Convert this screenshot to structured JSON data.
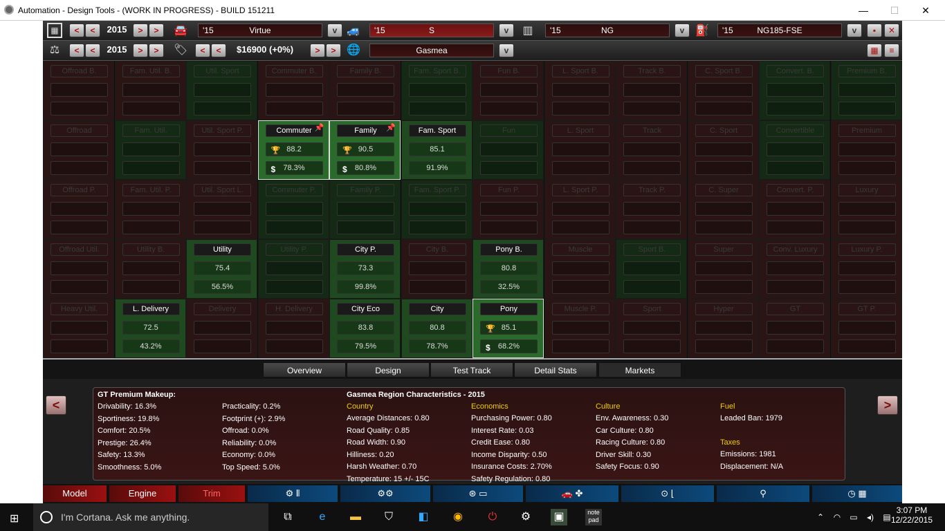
{
  "window": {
    "title": "Automation - Design Tools - (WORK IN PROGRESS) - BUILD 151211",
    "minimize": "—",
    "maximize": "☐",
    "close": "✕"
  },
  "toolbar1": {
    "year": "2015",
    "model_year": "'15",
    "model_name": "Virtue",
    "trim_year": "'15",
    "trim_name": "S",
    "chassis_year": "'15",
    "chassis_name": "NG",
    "engine_year": "'15",
    "engine_name": "NG185-FSE"
  },
  "toolbar2": {
    "year": "2015",
    "price": "$16900 (+0%)",
    "region": "Gasmea"
  },
  "grid": {
    "rows": [
      [
        {
          "label": "Offroad B.",
          "state": "dim",
          "color": "red"
        },
        {
          "label": "Fam. Util. B.",
          "state": "dim",
          "color": "red"
        },
        {
          "label": "Util. Sport",
          "state": "dim",
          "color": "green"
        },
        {
          "label": "Commuter B.",
          "state": "dim",
          "color": "red"
        },
        {
          "label": "Family B.",
          "state": "dim",
          "color": "red"
        },
        {
          "label": "Fam. Sport B.",
          "state": "dim",
          "color": "green"
        },
        {
          "label": "Fun B.",
          "state": "dim",
          "color": "red"
        },
        {
          "label": "L. Sport B.",
          "state": "dim",
          "color": "red"
        },
        {
          "label": "Track B.",
          "state": "dim",
          "color": "red"
        },
        {
          "label": "C. Sport B.",
          "state": "dim",
          "color": "red"
        },
        {
          "label": "Convert. B.",
          "state": "dim",
          "color": "green"
        },
        {
          "label": "Premium B.",
          "state": "dim",
          "color": "green"
        }
      ],
      [
        {
          "label": "Offroad",
          "state": "dim",
          "color": "red"
        },
        {
          "label": "Fam. Util.",
          "state": "dim",
          "color": "green"
        },
        {
          "label": "Util. Sport P.",
          "state": "dim",
          "color": "red"
        },
        {
          "label": "Commuter",
          "state": "sel",
          "color": "greenbright",
          "v1": "88.2",
          "v2": "78.3%",
          "trophy": true
        },
        {
          "label": "Family",
          "state": "sel",
          "color": "greenbright",
          "v1": "90.5",
          "v2": "80.8%",
          "trophy": true
        },
        {
          "label": "Fam. Sport",
          "state": "lit",
          "color": "green",
          "v1": "85.1",
          "v2": "91.9%"
        },
        {
          "label": "Fun",
          "state": "dim",
          "color": "green"
        },
        {
          "label": "L. Sport",
          "state": "dim",
          "color": "red"
        },
        {
          "label": "Track",
          "state": "dim",
          "color": "red"
        },
        {
          "label": "C. Sport",
          "state": "dim",
          "color": "red"
        },
        {
          "label": "Convertible",
          "state": "dim",
          "color": "green"
        },
        {
          "label": "Premium",
          "state": "dim",
          "color": "red"
        }
      ],
      [
        {
          "label": "Offroad P.",
          "state": "dim",
          "color": "red"
        },
        {
          "label": "Fam. Util. P.",
          "state": "dim",
          "color": "red"
        },
        {
          "label": "Util. Sport L.",
          "state": "dim",
          "color": "red"
        },
        {
          "label": "Commuter P.",
          "state": "dim",
          "color": "green"
        },
        {
          "label": "Family P.",
          "state": "dim",
          "color": "green"
        },
        {
          "label": "Fam. Sport P.",
          "state": "dim",
          "color": "green"
        },
        {
          "label": "Fun P.",
          "state": "dim",
          "color": "red"
        },
        {
          "label": "L. Sport P.",
          "state": "dim",
          "color": "red"
        },
        {
          "label": "Track P.",
          "state": "dim",
          "color": "red"
        },
        {
          "label": "C. Super",
          "state": "dim",
          "color": "red"
        },
        {
          "label": "Convert. P.",
          "state": "dim",
          "color": "red"
        },
        {
          "label": "Luxury",
          "state": "dim",
          "color": "red"
        }
      ],
      [
        {
          "label": "Offroad Util.",
          "state": "dim",
          "color": "red"
        },
        {
          "label": "Utility B.",
          "state": "dim",
          "color": "red"
        },
        {
          "label": "Utility",
          "state": "lit",
          "color": "green",
          "v1": "75.4",
          "v2": "56.5%"
        },
        {
          "label": "Utility P.",
          "state": "dim",
          "color": "green"
        },
        {
          "label": "City P.",
          "state": "lit",
          "color": "green",
          "v1": "73.3",
          "v2": "99.8%"
        },
        {
          "label": "City B.",
          "state": "dim",
          "color": "red"
        },
        {
          "label": "Pony B.",
          "state": "lit",
          "color": "green",
          "v1": "80.8",
          "v2": "32.5%"
        },
        {
          "label": "Muscle",
          "state": "dim",
          "color": "red"
        },
        {
          "label": "Sport B.",
          "state": "dim",
          "color": "green"
        },
        {
          "label": "Super",
          "state": "dim",
          "color": "red"
        },
        {
          "label": "Conv. Luxury",
          "state": "dim",
          "color": "red"
        },
        {
          "label": "Luxury P.",
          "state": "dim",
          "color": "red"
        }
      ],
      [
        {
          "label": "Heavy Util.",
          "state": "dim",
          "color": "red"
        },
        {
          "label": "L. Delivery",
          "state": "lit",
          "color": "green",
          "v1": "72.5",
          "v2": "43.2%"
        },
        {
          "label": "Delivery",
          "state": "dim",
          "color": "red"
        },
        {
          "label": "H. Delivery",
          "state": "dim",
          "color": "red"
        },
        {
          "label": "City Eco",
          "state": "lit",
          "color": "green",
          "v1": "83.8",
          "v2": "79.5%"
        },
        {
          "label": "City",
          "state": "lit",
          "color": "green",
          "v1": "80.8",
          "v2": "78.7%"
        },
        {
          "label": "Pony",
          "state": "sel",
          "color": "greenbright",
          "v1": "85.1",
          "v2": "68.2%",
          "trophy": true
        },
        {
          "label": "Muscle P.",
          "state": "dim",
          "color": "red"
        },
        {
          "label": "Sport",
          "state": "dim",
          "color": "red"
        },
        {
          "label": "Hyper",
          "state": "dim",
          "color": "red"
        },
        {
          "label": "GT",
          "state": "dim",
          "color": "red"
        },
        {
          "label": "GT P.",
          "state": "dim",
          "color": "red"
        }
      ]
    ]
  },
  "tabs": [
    "Overview",
    "Design",
    "Test Track",
    "Detail Stats",
    "Markets"
  ],
  "info": {
    "makeup_title": "GT Premium Makeup:",
    "makeup_col1": [
      "Drivability: 16.3%",
      "Sportiness: 19.8%",
      "Comfort: 20.5%",
      "Prestige: 26.4%",
      "Safety: 13.3%",
      "Smoothness: 5.0%"
    ],
    "makeup_col2": [
      "Practicality: 0.2%",
      "Footprint (+): 2.9%",
      "Offroad: 0.0%",
      "Reliability: 0.0%",
      "Economy: 0.0%",
      "Top Speed: 5.0%"
    ],
    "region_title": "Gasmea Region Characteristics - 2015",
    "country_h": "Country",
    "country": [
      "Average Distances: 0.80",
      "Road Quality: 0.85",
      "Road Width: 0.90",
      "Hilliness: 0.20",
      "Harsh Weather: 0.70",
      "Temperature: 15 +/- 15C"
    ],
    "economics_h": "Economics",
    "economics": [
      "Purchasing Power: 0.80",
      "Interest Rate: 0.03",
      "Credit Ease: 0.80",
      "Income Disparity: 0.50",
      "Insurance Costs: 2.70%",
      "Safety Regulation: 0.80"
    ],
    "culture_h": "Culture",
    "culture": [
      "Env. Awareness: 0.30",
      "Car Culture: 0.80",
      "Racing Culture: 0.80",
      "Driver Skill: 0.30",
      "Safety Focus: 0.90"
    ],
    "fuel_h": "Fuel",
    "fuel": [
      "Leaded Ban: 1979"
    ],
    "taxes_h": "Taxes",
    "taxes": [
      "Emissions: 1981",
      "Displacement: N/A"
    ]
  },
  "bottom": {
    "model": "Model",
    "engine": "Engine",
    "trim": "Trim"
  },
  "taskbar": {
    "cortana": "I'm Cortana. Ask me anything.",
    "time": "3:07 PM",
    "date": "12/22/2015"
  }
}
